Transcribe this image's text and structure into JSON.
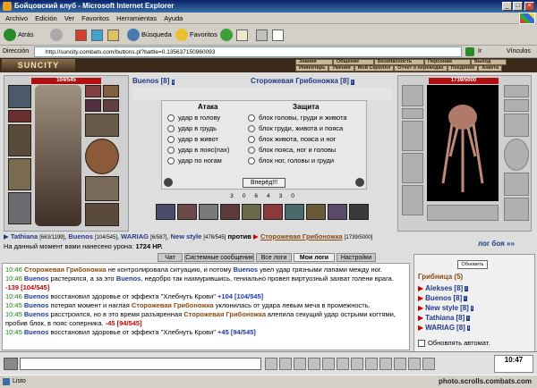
{
  "window": {
    "title": "Бойцовский клуб - Microsoft Internet Explorer"
  },
  "menu": [
    "Archivo",
    "Edición",
    "Ver",
    "Favoritos",
    "Herramientas",
    "Ayuda"
  ],
  "toolbar": {
    "back": "Atrás",
    "search": "Búsqueda",
    "favorites": "Favoritos"
  },
  "address": {
    "label": "Dirección",
    "url": "http://suncity.combats.com/buttons.pl?battle=0.135637150960093",
    "go": "Ir",
    "links": "Vínculos"
  },
  "game": {
    "logo": "SUNCITY",
    "nav_top": [
      "Знания",
      "Общение",
      "Безопасность",
      "Персонаж",
      "Выход"
    ],
    "nav_bottom": [
      "Инвентарь",
      "Умения",
      "Мой Скроллл",
      "Отчет о переводах",
      "Поединки",
      "Анкета"
    ],
    "left_hp": "104/545",
    "right_hp": "1739/5000",
    "player": {
      "name": "Buenos",
      "level": "[8]"
    },
    "enemy": {
      "name": "Сторожевая Грибоножка",
      "level": "[8]"
    },
    "attack_title": "Атака",
    "defense_title": "Защита",
    "attacks": [
      "удар в голову",
      "удар в грудь",
      "удар в живот",
      "удар в пояс(пах)",
      "удар по ногам"
    ],
    "defenses": [
      "блок головы, груди и живота",
      "блок груди, живота и пояса",
      "блок живота, пояса и ног",
      "блок пояса, ног и головы",
      "блок ног, головы и груди"
    ],
    "forward": "Вперёд!!!",
    "stats": [
      "3",
      "0",
      "6",
      "4",
      "3",
      "0"
    ],
    "team_line": {
      "members": [
        "Tathiana",
        "Buenos",
        "WARIAG",
        "New style"
      ],
      "members_hp": [
        "[663/1199]",
        "[104/545]",
        "[6/587]",
        "[478/545]"
      ],
      "versus": "против",
      "enemy_name": "Сторожевая Грибоножка",
      "enemy_hp": "[1739/5000]"
    },
    "damage_line": {
      "text": "На данный момент вами нанесено урона:",
      "value": "1724 HP."
    },
    "battle_log": "лог боя »»"
  },
  "chat": {
    "tabs": [
      "Чат",
      "Системные сообщения",
      "Все логи",
      "Мои логи",
      "Настройки"
    ],
    "active_tab": "Мои логи",
    "lines": [
      {
        "time": "10:46",
        "actor": "Сторожевая Грибоножка",
        "text": " не контролировала ситуацию, и потому ",
        "actor2": "Buenos",
        "text2": " увел удар грязными лапами между ног.",
        "value": ""
      },
      {
        "time": "10:46",
        "actor": "Buenos",
        "text": " растерялся, а за это ",
        "actor2": "Buenos",
        "text2": ", недобро так нахмурившись, гениально провел виртуозный захват голени врага. ",
        "value": "-139 [104/545]"
      },
      {
        "time": "10:46",
        "actor": "Buenos",
        "text": " восстановил здоровье от эффекта \"Хлебнуть Крови\" ",
        "actor2": "",
        "text2": "",
        "value": "+104 [104/545]"
      },
      {
        "time": "10:45",
        "actor": "Buenos",
        "text": " потерял момент и наглая ",
        "actor2": "Сторожевая Грибоножка",
        "text2": " уклонилась от удара левым меча в промежность.",
        "value": ""
      },
      {
        "time": "10:45",
        "actor": "Buenos",
        "text": " расстроился, но в это время разъяренная ",
        "actor2": "Сторожевая Грибоножка",
        "text2": " влепила секущий удар острыми когтями, пробив блок, в пояс соперника. ",
        "value": "-45 [94/545]"
      },
      {
        "time": "10:45",
        "actor": "Buenos",
        "text": " восстановил здоровье от эффекта \"Хлебнуть Крови\" ",
        "actor2": "",
        "text2": "",
        "value": "+45 [94/545]"
      }
    ]
  },
  "sidebar": {
    "refresh": "Обновить",
    "room": "Грибница (5)",
    "users": [
      {
        "name": "Alekses",
        "level": "[8]"
      },
      {
        "name": "Buenos",
        "level": "[8]"
      },
      {
        "name": "New style",
        "level": "[8]"
      },
      {
        "name": "Tathiana",
        "level": "[8]"
      },
      {
        "name": "WARIAG",
        "level": "[8]"
      }
    ],
    "auto_refresh": "Обновлять автомат."
  },
  "taskbar": {
    "time": "10:47"
  },
  "status": {
    "text": "Listo"
  },
  "watermark": "photo.scrolls.combats.com"
}
